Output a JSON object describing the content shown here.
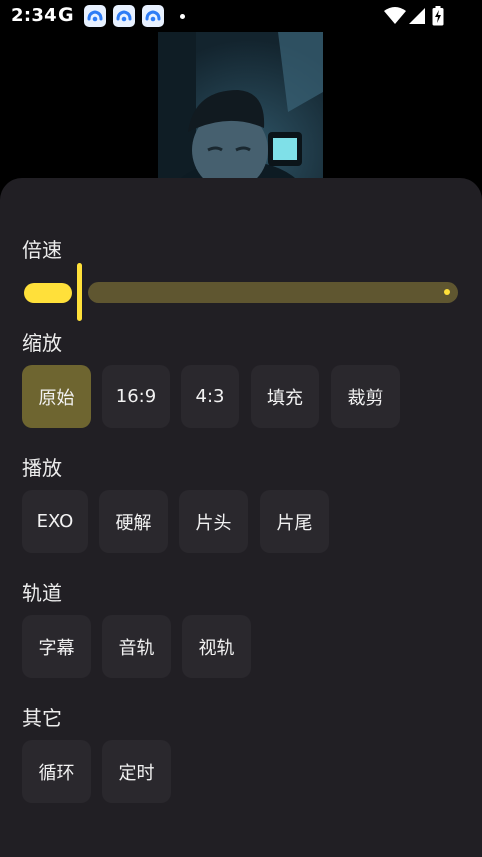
{
  "status_bar": {
    "time": "2:34",
    "g_letter": "G",
    "icons": [
      "google-icon",
      "app-cloud-icon",
      "app-cloud-icon",
      "app-cloud-icon",
      "notification-dot-icon",
      "wifi-icon",
      "signal-icon",
      "battery-charging-icon"
    ]
  },
  "panel": {
    "speed": {
      "title": "倍速",
      "slider_value": 0.16,
      "accent": "#ffe03a"
    },
    "scale": {
      "title": "缩放",
      "options": [
        "原始",
        "16:9",
        "4:3",
        "填充",
        "裁剪"
      ],
      "selected": "原始"
    },
    "playback": {
      "title": "播放",
      "options": [
        "EXO",
        "硬解",
        "片头",
        "片尾"
      ]
    },
    "tracks": {
      "title": "轨道",
      "options": [
        "字幕",
        "音轨",
        "视轨"
      ]
    },
    "other": {
      "title": "其它",
      "options": [
        "循环",
        "定时"
      ]
    }
  },
  "colors": {
    "panel_bg": "#211f24",
    "chip_bg": "#2a282d",
    "chip_active_bg": "#6e6530",
    "track_bg": "#5f5630"
  }
}
